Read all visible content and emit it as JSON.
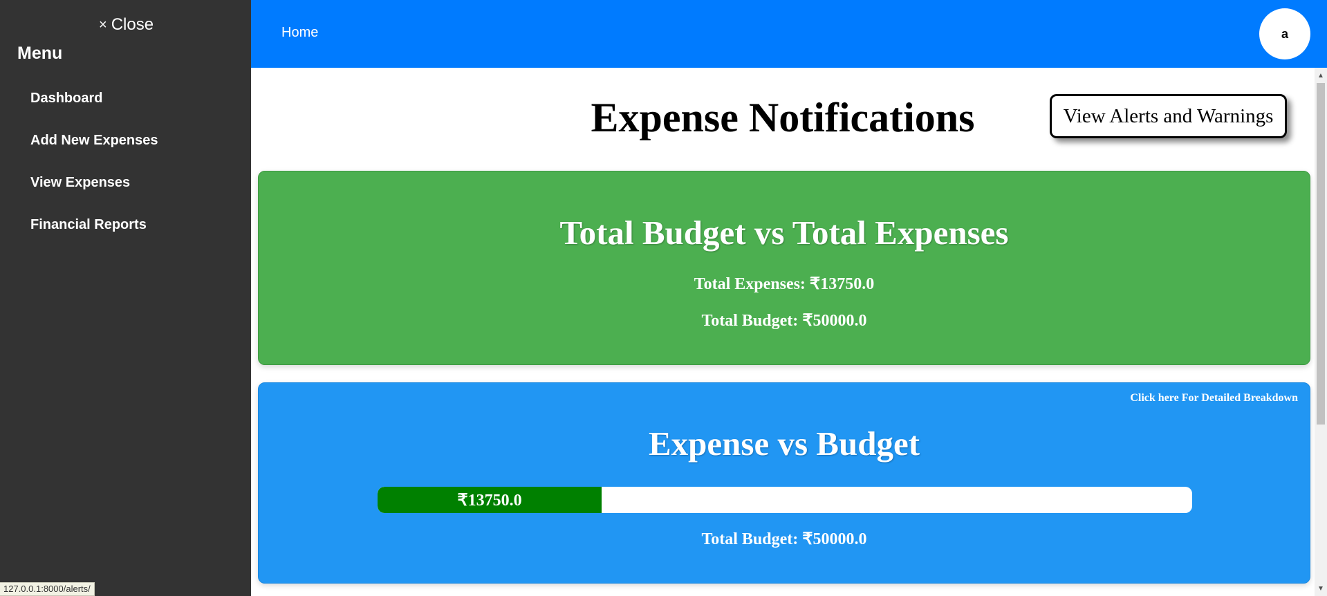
{
  "sidebar": {
    "close_label": "Close",
    "close_icon": "×",
    "menu_title": "Menu",
    "items": [
      {
        "label": "Dashboard"
      },
      {
        "label": "Add New Expenses"
      },
      {
        "label": "View Expenses"
      },
      {
        "label": "Financial Reports"
      }
    ]
  },
  "topnav": {
    "home_label": "Home",
    "avatar_initial": "a",
    "bg_color": "#007bff"
  },
  "main": {
    "title": "Expense Notifications",
    "alerts_button": "View Alerts and Warnings",
    "summary_card": {
      "heading": "Total Budget vs Total Expenses",
      "total_expenses": "Total Expenses: ₹13750.0",
      "total_budget": "Total Budget: ₹50000.0",
      "color": "#4caf50"
    },
    "progress_card": {
      "breakdown_link": "Click here For Detailed Breakdown",
      "heading": "Expense vs Budget",
      "progress_label": "₹13750.0",
      "progress_fraction": 0.275,
      "budget_line": "Total Budget: ₹50000.0",
      "color": "#2196f3",
      "fill_color": "#008000"
    }
  },
  "status_bar": {
    "url": "127.0.0.1:8000/alerts/"
  }
}
